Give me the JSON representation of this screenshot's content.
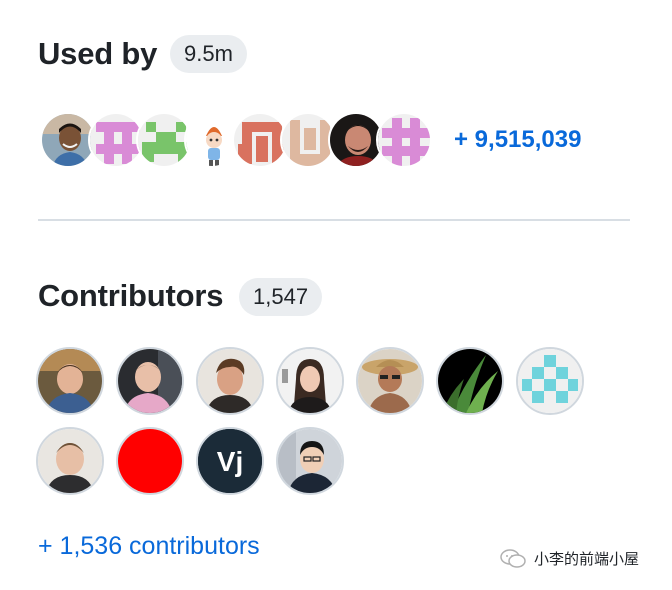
{
  "used_by": {
    "title": "Used by",
    "count_badge": "9.5m",
    "more_link": "+ 9,515,039"
  },
  "contributors": {
    "title": "Contributors",
    "count_badge": "1,547",
    "more_link": "+ 1,536 contributors"
  },
  "watermark": {
    "text": "小李的前端小屋"
  },
  "colors": {
    "link": "#0969da",
    "badge_bg": "#eaedf0",
    "divider": "#d8dee4"
  }
}
